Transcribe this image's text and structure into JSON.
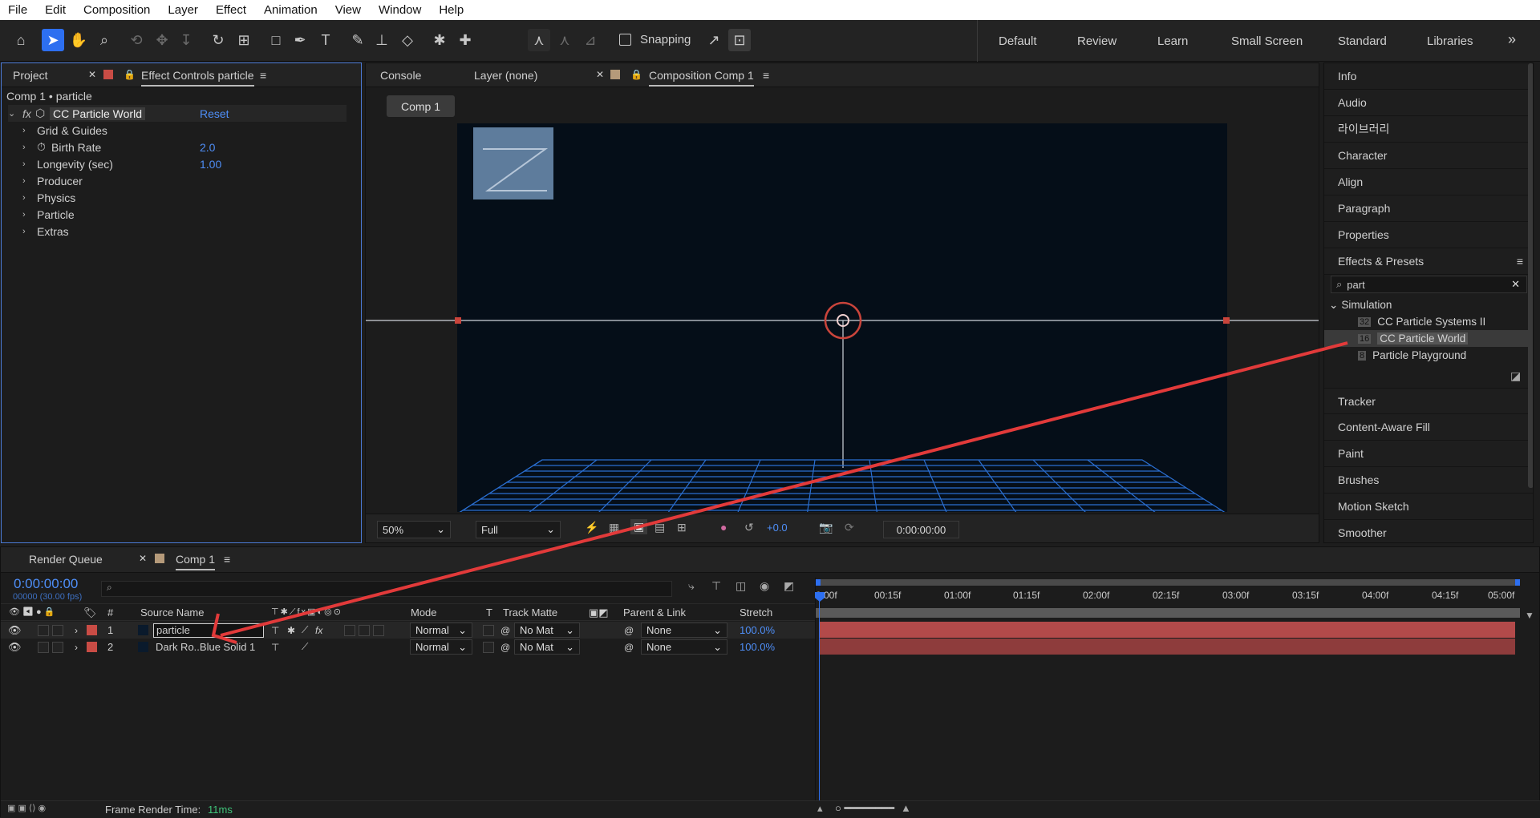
{
  "menu": [
    "File",
    "Edit",
    "Composition",
    "Layer",
    "Effect",
    "Animation",
    "View",
    "Window",
    "Help"
  ],
  "toolbar": {
    "snapping": "Snapping",
    "workspaces": [
      "Default",
      "Review",
      "Learn",
      "Small Screen",
      "Standard",
      "Libraries"
    ],
    "more": "»"
  },
  "left_panel": {
    "tab_project": "Project",
    "tab_effect_controls": "Effect Controls particle",
    "path": "Comp 1 • particle",
    "effect_name": "CC Particle World",
    "reset": "Reset",
    "props": [
      {
        "label": "Grid & Guides",
        "value": ""
      },
      {
        "label": "Birth Rate",
        "value": "2.0"
      },
      {
        "label": "Longevity (sec)",
        "value": "1.00"
      },
      {
        "label": "Producer",
        "value": ""
      },
      {
        "label": "Physics",
        "value": ""
      },
      {
        "label": "Particle",
        "value": ""
      },
      {
        "label": "Extras",
        "value": ""
      }
    ]
  },
  "viewer": {
    "tab_console": "Console",
    "tab_layer": "Layer (none)",
    "tab_comp": "Composition Comp 1",
    "breadcrumb": "Comp 1",
    "zoom": "50%",
    "resolution": "Full",
    "exposure": "+0.0",
    "timecode": "0:00:00:00"
  },
  "right_panel": {
    "items": [
      "Info",
      "Audio",
      "라이브러리",
      "Character",
      "Align",
      "Paragraph",
      "Properties"
    ],
    "effects_title": "Effects & Presets",
    "search_value": "part",
    "category": "Simulation",
    "presets": [
      "CC Particle Systems II",
      "CC Particle World",
      "Particle Playground"
    ],
    "items2": [
      "Tracker",
      "Content-Aware Fill",
      "Paint",
      "Brushes",
      "Motion Sketch",
      "Smoother"
    ]
  },
  "timeline": {
    "tab_render": "Render Queue",
    "tab_comp": "Comp 1",
    "timecode": "0:00:00:00",
    "fps": "00000 (30.00 fps)",
    "headers": {
      "num": "#",
      "source": "Source Name",
      "mode": "Mode",
      "t": "T",
      "matte": "Track Matte",
      "parent": "Parent & Link",
      "stretch": "Stretch"
    },
    "ruler": [
      "0:00f",
      "00:15f",
      "01:00f",
      "01:15f",
      "02:00f",
      "02:15f",
      "03:00f",
      "03:15f",
      "04:00f",
      "04:15f",
      "05:00f"
    ],
    "layers": [
      {
        "num": "1",
        "name": "particle",
        "mode": "Normal",
        "matte": "No Mat",
        "parent": "None",
        "stretch": "100.0%"
      },
      {
        "num": "2",
        "name": "Dark Ro..Blue Solid 1",
        "mode": "Normal",
        "matte": "No Mat",
        "parent": "None",
        "stretch": "100.0%"
      }
    ],
    "render_time_label": "Frame Render Time:",
    "render_time_value": "11ms"
  },
  "colors": {
    "accent": "#2d6ff0",
    "value_blue": "#4e8ef7",
    "layer_red": "#c94c45",
    "bar_red": "#b34a4a",
    "arrow_red": "#e23a3a",
    "render_green": "#3fc47a"
  }
}
